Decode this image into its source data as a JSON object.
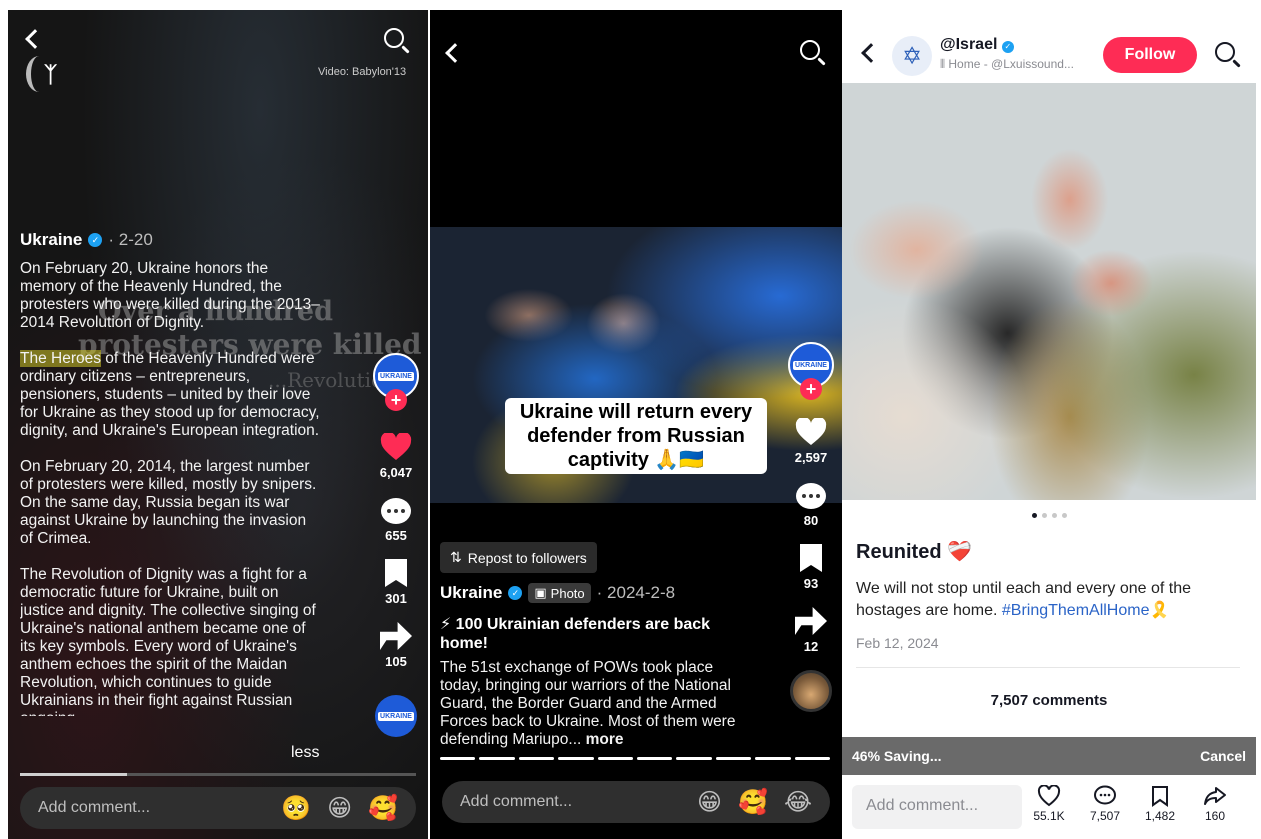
{
  "panel1": {
    "video_credit": "Video: Babylon'13",
    "overlay_lines": [
      "Over a hundred",
      "protesters were killed"
    ],
    "overlay_faint": "...Revolution",
    "author": "Ukraine",
    "date": "· 2-20",
    "paragraphs": [
      "On February 20, Ukraine honors the memory of the Heavenly Hundred, the protesters who were killed during the 2013–2014 Revolution of Dignity.",
      "of the Heavenly Hundred were ordinary citizens – entrepreneurs, pensioners, students – united by their love for Ukraine as they stood up for democracy, dignity, and Ukraine's European integration.",
      "On February 20, 2014, the largest number of protesters were killed, mostly by snipers. On the same day, Russia began its war against Ukraine by launching the invasion of Crimea.",
      "The Revolution of Dignity was a fight for a democratic future for Ukraine, built on justice and dignity. The collective singing of Ukraine's national anthem became one of its key symbols. Every word of Ukraine's anthem echoes the spirit of the Maidan Revolution, which continues to guide Ukrainians in their fight against Russian ongoing..."
    ],
    "highlight": "The Heroes",
    "less_label": "less",
    "likes": "6,047",
    "comments": "655",
    "saves": "301",
    "shares": "105",
    "avatar_label": "UKRAINE",
    "comment_placeholder": "Add comment...",
    "emojis": [
      "🥺",
      "😁",
      "🥰"
    ],
    "progress": 0.27
  },
  "panel2": {
    "sticker": "Ukraine will return every defender from Russian captivity 🙏🇺🇦",
    "repost_label": "Repost to followers",
    "author": "Ukraine",
    "photo_chip": "Photo",
    "date": "· 2024-2-8",
    "headline": "⚡ 100 Ukrainian defenders are back home!",
    "body": "The 51st exchange of POWs took place today, bringing our warriors of the National Guard, the Border Guard and the Armed Forces back to Ukraine. Most of them were defending Mariupo...",
    "more_label": "more",
    "likes": "2,597",
    "comments": "80",
    "saves": "93",
    "shares": "12",
    "avatar_label": "UKRAINE",
    "comment_placeholder": "Add comment...",
    "emojis": [
      "😁",
      "🥰",
      "😂"
    ],
    "segment_count": 10
  },
  "panel3": {
    "handle": "@Israel",
    "subtitle": "Home - @Lxuissound...",
    "follow_label": "Follow",
    "title": "Reunited ❤️‍🩹",
    "body": "We will not stop until each and every one of the hostages are home.",
    "hashtag": "#BringThemAllHome",
    "ribbon": "🎗️",
    "date": "Feb 12, 2024",
    "comments_heading": "7,507 comments",
    "saving_text": "46% Saving...",
    "cancel_label": "Cancel",
    "comment_placeholder": "Add comment...",
    "likes": "55.1K",
    "comments": "7,507",
    "saves": "1,482",
    "shares": "160",
    "page_dots": 4,
    "active_dot": 0
  }
}
